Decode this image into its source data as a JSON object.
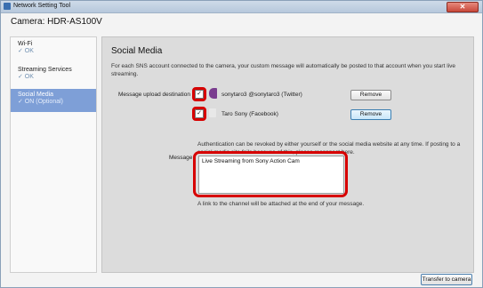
{
  "window": {
    "title": "Network Setting Tool",
    "close_symbol": "✕"
  },
  "camera_label": "Camera: HDR-AS100V",
  "sidebar": {
    "items": [
      {
        "label": "Wi-Fi",
        "status": "✓ OK",
        "active": false
      },
      {
        "label": "Streaming Services",
        "status": "✓ OK",
        "active": false
      },
      {
        "label": "Social Media",
        "status": "✓ ON (Optional)",
        "active": true
      }
    ]
  },
  "main": {
    "heading": "Social Media",
    "description": "For each SNS account connected to the camera, your custom message will automatically be posted to that account when you start live streaming.",
    "upload_label": "Message upload destination",
    "accounts": [
      {
        "name": "sonytaro3 @sonytaro3 (Twitter)",
        "checked": "✓",
        "remove_label": "Remove"
      },
      {
        "name": "Taro  Sony (Facebook)",
        "checked": "✓",
        "remove_label": "Remove"
      }
    ],
    "auth_text": "Authentication can be revoked by either yourself or the social media website at any time. If posting to a social media site fails because of this, please reconnect here.",
    "message_label": "Message",
    "message_value": "Live Streaming from Sony Action Cam",
    "note": "A link to the channel will be attached at the end of your message."
  },
  "footer": {
    "transfer_label": "Transfer to camera"
  },
  "colors": {
    "highlight": "#d70000",
    "active_item": "#7e9fd7",
    "status_text": "#6f8fb0"
  }
}
